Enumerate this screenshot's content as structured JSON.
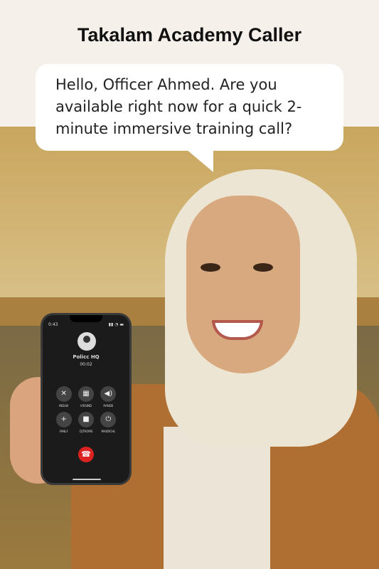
{
  "title": "Takalam Academy Caller",
  "speech": "Hello, Officer Ahmed. Are you available right now for a quick 2-minute immersive training call?",
  "phone": {
    "time": "0:43",
    "caller": "Policc HQ",
    "duration": "00:02",
    "buttons": [
      {
        "icon": "mute-icon",
        "glyph": "✕",
        "label": "INDLW"
      },
      {
        "icon": "keypad-icon",
        "glyph": "▦",
        "label": "VISSIND"
      },
      {
        "icon": "speaker-icon",
        "glyph": "◀)",
        "label": "RANDE"
      },
      {
        "icon": "add-call-icon",
        "glyph": "+",
        "label": "FANLF"
      },
      {
        "icon": "video-icon",
        "glyph": "■",
        "label": "OJTROMS"
      },
      {
        "icon": "hold-icon",
        "glyph": "⏻",
        "label": "MAIDICHL"
      }
    ],
    "end_glyph": "☎"
  },
  "colors": {
    "end_call": "#dd2222",
    "wall": "#c9a65e",
    "jacket": "#b06f32"
  }
}
